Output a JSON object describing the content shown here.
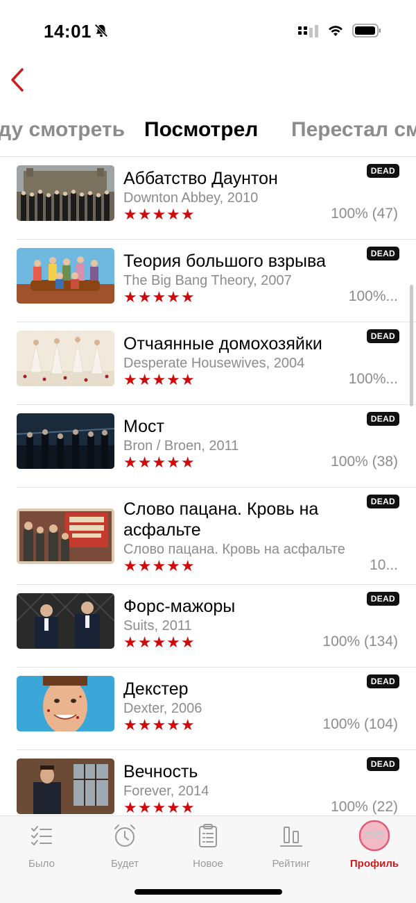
{
  "status_bar": {
    "time": "14:01",
    "icons": [
      "bell-slash-icon",
      "signal-icon",
      "wifi-icon",
      "battery-icon"
    ]
  },
  "nav": {
    "back_icon": "chevron-left-icon"
  },
  "tabs": [
    {
      "label": "Буду смотреть",
      "active": false
    },
    {
      "label": "Посмотрел",
      "active": true
    },
    {
      "label": "Перестал смотреть",
      "active": false
    }
  ],
  "rating_stars": "★★★★★",
  "shows": [
    {
      "title": "Аббатство Даунтон",
      "original": "Downton Abbey, 2010",
      "percent": "100% (47)",
      "badge": "DEAD"
    },
    {
      "title": "Теория большого взрыва",
      "original": "The Big Bang Theory, 2007",
      "percent": "100%...",
      "badge": "DEAD"
    },
    {
      "title": "Отчаянные домохозяйки",
      "original": "Desperate Housewives, 2004",
      "percent": "100%...",
      "badge": "DEAD"
    },
    {
      "title": "Мост",
      "original": "Bron / Broen, 2011",
      "percent": "100% (38)",
      "badge": "DEAD"
    },
    {
      "title": "Слово пацана. Кровь на асфальте",
      "original": "Слово пацана. Кровь на асфальте",
      "percent": "10...",
      "badge": "DEAD"
    },
    {
      "title": "Форс-мажоры",
      "original": "Suits, 2011",
      "percent": "100% (134)",
      "badge": "DEAD"
    },
    {
      "title": "Декстер",
      "original": "Dexter, 2006",
      "percent": "100% (104)",
      "badge": "DEAD"
    },
    {
      "title": "Вечность",
      "original": "Forever, 2014",
      "percent": "100% (22)",
      "badge": "DEAD"
    }
  ],
  "tabbar": [
    {
      "label": "Было",
      "icon": "checklist-icon",
      "active": false
    },
    {
      "label": "Будет",
      "icon": "alarm-clock-icon",
      "active": false
    },
    {
      "label": "Новое",
      "icon": "clipboard-icon",
      "active": false
    },
    {
      "label": "Рейтинг",
      "icon": "bar-chart-icon",
      "active": false
    },
    {
      "label": "Профиль",
      "icon": "profile-glasses-icon",
      "active": true
    }
  ],
  "colors": {
    "accent": "#cc1d1d",
    "star": "#cf0a0a",
    "muted": "#8c8c8c",
    "badge_bg": "#111111"
  }
}
